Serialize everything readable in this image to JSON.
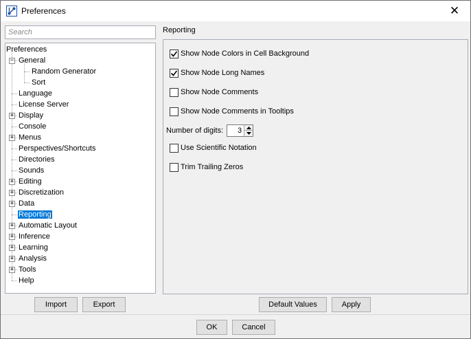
{
  "window": {
    "title": "Preferences",
    "close_glyph": "✕",
    "icon": "app-logo-icon"
  },
  "search": {
    "placeholder": "Search",
    "value": ""
  },
  "tree": {
    "root": "Preferences",
    "items": [
      {
        "label": "General",
        "expandable": true,
        "expanded": true
      },
      {
        "label": "Random Generator",
        "level": 2
      },
      {
        "label": "Sort",
        "level": 2
      },
      {
        "label": "Language"
      },
      {
        "label": "License Server"
      },
      {
        "label": "Display",
        "expandable": true
      },
      {
        "label": "Console"
      },
      {
        "label": "Menus",
        "expandable": true
      },
      {
        "label": "Perspectives/Shortcuts"
      },
      {
        "label": "Directories"
      },
      {
        "label": "Sounds"
      },
      {
        "label": "Editing",
        "expandable": true
      },
      {
        "label": "Discretization",
        "expandable": true
      },
      {
        "label": "Data",
        "expandable": true
      },
      {
        "label": "Reporting",
        "selected": true
      },
      {
        "label": "Automatic Layout",
        "expandable": true
      },
      {
        "label": "Inference",
        "expandable": true
      },
      {
        "label": "Learning",
        "expandable": true
      },
      {
        "label": "Analysis",
        "expandable": true
      },
      {
        "label": "Tools",
        "expandable": true
      },
      {
        "label": "Help"
      }
    ]
  },
  "left_buttons": {
    "import": "Import",
    "export": "Export"
  },
  "reporting": {
    "title": "Reporting",
    "options": [
      {
        "label": "Show Node Colors in Cell Background",
        "checked": true
      },
      {
        "label": "Show Node Long Names",
        "checked": true
      },
      {
        "label": "Show Node Comments",
        "checked": false
      },
      {
        "label": "Show Node Comments in Tooltips",
        "checked": false
      }
    ],
    "digits_label": "Number of digits:",
    "digits_value": "3",
    "options2": [
      {
        "label": "Use Scientific Notation",
        "checked": false
      },
      {
        "label": "Trim Trailing Zeros",
        "checked": false
      }
    ],
    "default_values": "Default Values",
    "apply": "Apply"
  },
  "footer": {
    "ok": "OK",
    "cancel": "Cancel"
  },
  "colors": {
    "selection": "#0078d7",
    "border": "#a5acb5",
    "button_bg": "#e1e1e1"
  }
}
